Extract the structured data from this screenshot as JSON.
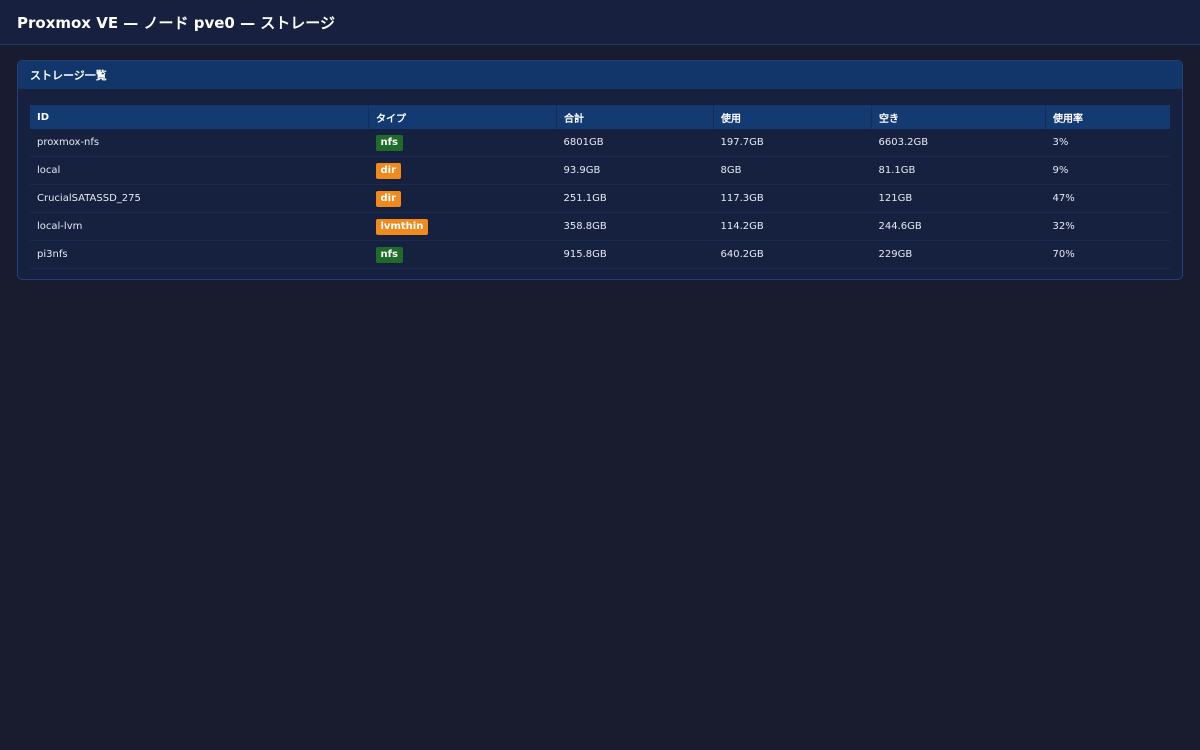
{
  "app": {
    "title": "Proxmox VE — ノード pve0 — ストレージ"
  },
  "panel": {
    "title": "ストレージ一覧"
  },
  "table": {
    "headers": [
      "ID",
      "タイプ",
      "合計",
      "使用",
      "空き",
      "使用率"
    ],
    "rows": [
      {
        "id": "proxmox-nfs",
        "type": "nfs",
        "total": "6801GB",
        "used": "197.7GB",
        "free": "6603.2GB",
        "usage": "3%"
      },
      {
        "id": "local",
        "type": "dir",
        "total": "93.9GB",
        "used": "8GB",
        "free": "81.1GB",
        "usage": "9%"
      },
      {
        "id": "CrucialSATASSD_275",
        "type": "dir",
        "total": "251.1GB",
        "used": "117.3GB",
        "free": "121GB",
        "usage": "47%"
      },
      {
        "id": "local-lvm",
        "type": "lvmthin",
        "total": "358.8GB",
        "used": "114.2GB",
        "free": "244.6GB",
        "usage": "32%"
      },
      {
        "id": "pi3nfs",
        "type": "nfs",
        "total": "915.8GB",
        "used": "640.2GB",
        "free": "229GB",
        "usage": "70%"
      }
    ]
  },
  "colors": {
    "background": "#191b2e",
    "topbar": "#17213f",
    "panel_header": "#12356a",
    "table_header": "#143a72",
    "badge_nfs": "#1f6b2a",
    "badge_dir": "#f08a1c",
    "badge_lvmthin": "#f08a1c"
  }
}
